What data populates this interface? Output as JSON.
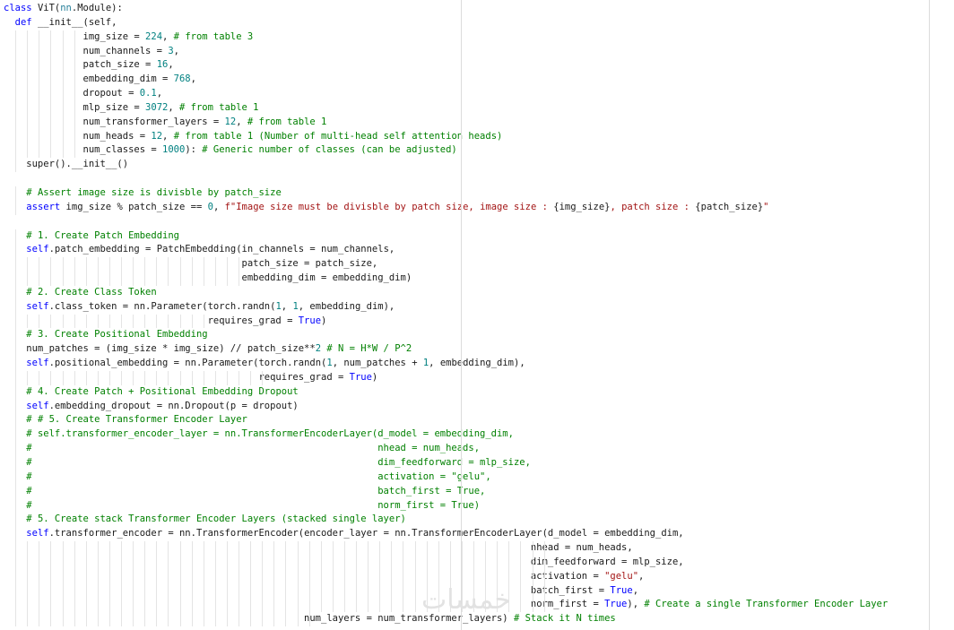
{
  "editor": {
    "lines": [
      [
        {
          "t": "kw",
          "s": "class "
        },
        {
          "t": "plain",
          "s": "ViT("
        },
        {
          "t": "bi",
          "s": "nn"
        },
        {
          "t": "plain",
          "s": ".Module):"
        }
      ],
      [
        {
          "t": "plain",
          "s": "  "
        },
        {
          "t": "kw",
          "s": "def "
        },
        {
          "t": "plain",
          "s": "__init__(self,"
        }
      ],
      [
        {
          "t": "plain",
          "s": "              img_size = "
        },
        {
          "t": "num",
          "s": "224"
        },
        {
          "t": "plain",
          "s": ", "
        },
        {
          "t": "com",
          "s": "# from table 3"
        }
      ],
      [
        {
          "t": "plain",
          "s": "              num_channels = "
        },
        {
          "t": "num",
          "s": "3"
        },
        {
          "t": "plain",
          "s": ","
        }
      ],
      [
        {
          "t": "plain",
          "s": "              patch_size = "
        },
        {
          "t": "num",
          "s": "16"
        },
        {
          "t": "plain",
          "s": ","
        }
      ],
      [
        {
          "t": "plain",
          "s": "              embedding_dim = "
        },
        {
          "t": "num",
          "s": "768"
        },
        {
          "t": "plain",
          "s": ","
        }
      ],
      [
        {
          "t": "plain",
          "s": "              dropout = "
        },
        {
          "t": "num",
          "s": "0.1"
        },
        {
          "t": "plain",
          "s": ","
        }
      ],
      [
        {
          "t": "plain",
          "s": "              mlp_size = "
        },
        {
          "t": "num",
          "s": "3072"
        },
        {
          "t": "plain",
          "s": ", "
        },
        {
          "t": "com",
          "s": "# from table 1"
        }
      ],
      [
        {
          "t": "plain",
          "s": "              num_transformer_layers = "
        },
        {
          "t": "num",
          "s": "12"
        },
        {
          "t": "plain",
          "s": ", "
        },
        {
          "t": "com",
          "s": "# from table 1"
        }
      ],
      [
        {
          "t": "plain",
          "s": "              num_heads = "
        },
        {
          "t": "num",
          "s": "12"
        },
        {
          "t": "plain",
          "s": ", "
        },
        {
          "t": "com",
          "s": "# from table 1 (Number of multi-head self attention heads)"
        }
      ],
      [
        {
          "t": "plain",
          "s": "              num_classes = "
        },
        {
          "t": "num",
          "s": "1000"
        },
        {
          "t": "plain",
          "s": "): "
        },
        {
          "t": "com",
          "s": "# Generic number of classes (can be adjusted)"
        }
      ],
      [
        {
          "t": "plain",
          "s": "    super().__init__()"
        }
      ],
      [
        {
          "t": "plain",
          "s": ""
        }
      ],
      [
        {
          "t": "plain",
          "s": "    "
        },
        {
          "t": "com",
          "s": "# Assert image size is divisble by patch_size"
        }
      ],
      [
        {
          "t": "plain",
          "s": "    "
        },
        {
          "t": "kw",
          "s": "assert"
        },
        {
          "t": "plain",
          "s": " img_size % patch_size == "
        },
        {
          "t": "num",
          "s": "0"
        },
        {
          "t": "plain",
          "s": ", "
        },
        {
          "t": "str",
          "s": "f\"Image size must be divisble by patch size, image size : "
        },
        {
          "t": "plain",
          "s": "{img_size}"
        },
        {
          "t": "str",
          "s": ", patch size : "
        },
        {
          "t": "plain",
          "s": "{patch_size}"
        },
        {
          "t": "str",
          "s": "\""
        }
      ],
      [
        {
          "t": "plain",
          "s": ""
        }
      ],
      [
        {
          "t": "plain",
          "s": "    "
        },
        {
          "t": "com",
          "s": "# 1. Create Patch Embedding"
        }
      ],
      [
        {
          "t": "plain",
          "s": "    "
        },
        {
          "t": "self",
          "s": "self"
        },
        {
          "t": "plain",
          "s": ".patch_embedding = PatchEmbedding(in_channels = num_channels,"
        }
      ],
      [
        {
          "t": "plain",
          "s": "                                          patch_size = patch_size,"
        }
      ],
      [
        {
          "t": "plain",
          "s": "                                          embedding_dim = embedding_dim)"
        }
      ],
      [
        {
          "t": "plain",
          "s": "    "
        },
        {
          "t": "com",
          "s": "# 2. Create Class Token"
        }
      ],
      [
        {
          "t": "plain",
          "s": "    "
        },
        {
          "t": "self",
          "s": "self"
        },
        {
          "t": "plain",
          "s": ".class_token = nn.Parameter(torch.randn("
        },
        {
          "t": "num",
          "s": "1"
        },
        {
          "t": "plain",
          "s": ", "
        },
        {
          "t": "num",
          "s": "1"
        },
        {
          "t": "plain",
          "s": ", embedding_dim),"
        }
      ],
      [
        {
          "t": "plain",
          "s": "                                    requires_grad = "
        },
        {
          "t": "kw",
          "s": "True"
        },
        {
          "t": "plain",
          "s": ")"
        }
      ],
      [
        {
          "t": "plain",
          "s": "    "
        },
        {
          "t": "com",
          "s": "# 3. Create Positional Embedding"
        }
      ],
      [
        {
          "t": "plain",
          "s": "    num_patches = (img_size * img_size) // patch_size**"
        },
        {
          "t": "num",
          "s": "2"
        },
        {
          "t": "plain",
          "s": " "
        },
        {
          "t": "com",
          "s": "# N = H*W / P^2"
        }
      ],
      [
        {
          "t": "plain",
          "s": "    "
        },
        {
          "t": "self",
          "s": "self"
        },
        {
          "t": "plain",
          "s": ".positional_embedding = nn.Parameter(torch.randn("
        },
        {
          "t": "num",
          "s": "1"
        },
        {
          "t": "plain",
          "s": ", num_patches + "
        },
        {
          "t": "num",
          "s": "1"
        },
        {
          "t": "plain",
          "s": ", embedding_dim),"
        }
      ],
      [
        {
          "t": "plain",
          "s": "                                             requires_grad = "
        },
        {
          "t": "kw",
          "s": "True"
        },
        {
          "t": "plain",
          "s": ")"
        }
      ],
      [
        {
          "t": "plain",
          "s": "    "
        },
        {
          "t": "com",
          "s": "# 4. Create Patch + Positional Embedding Dropout"
        }
      ],
      [
        {
          "t": "plain",
          "s": "    "
        },
        {
          "t": "self",
          "s": "self"
        },
        {
          "t": "plain",
          "s": ".embedding_dropout = nn.Dropout(p = dropout)"
        }
      ],
      [
        {
          "t": "plain",
          "s": "    "
        },
        {
          "t": "com",
          "s": "# # 5. Create Transformer Encoder Layer"
        }
      ],
      [
        {
          "t": "plain",
          "s": "    "
        },
        {
          "t": "com",
          "s": "# self.transformer_encoder_layer = nn.TransformerEncoderLayer(d_model = embedding_dim,"
        }
      ],
      [
        {
          "t": "plain",
          "s": "    "
        },
        {
          "t": "com",
          "s": "#                                                             nhead = num_heads,"
        }
      ],
      [
        {
          "t": "plain",
          "s": "    "
        },
        {
          "t": "com",
          "s": "#                                                             dim_feedforward = mlp_size,"
        }
      ],
      [
        {
          "t": "plain",
          "s": "    "
        },
        {
          "t": "com",
          "s": "#                                                             activation = \"gelu\","
        }
      ],
      [
        {
          "t": "plain",
          "s": "    "
        },
        {
          "t": "com",
          "s": "#                                                             batch_first = True,"
        }
      ],
      [
        {
          "t": "plain",
          "s": "    "
        },
        {
          "t": "com",
          "s": "#                                                             norm_first = True)"
        }
      ],
      [
        {
          "t": "plain",
          "s": "    "
        },
        {
          "t": "com",
          "s": "# 5. Create stack Transformer Encoder Layers (stacked single layer)"
        }
      ],
      [
        {
          "t": "plain",
          "s": "    "
        },
        {
          "t": "self",
          "s": "self"
        },
        {
          "t": "plain",
          "s": ".transformer_encoder = nn.TransformerEncoder(encoder_layer = nn.TransformerEncoderLayer(d_model = embedding_dim,"
        }
      ],
      [
        {
          "t": "plain",
          "s": "                                                                                             nhead = num_heads,"
        }
      ],
      [
        {
          "t": "plain",
          "s": "                                                                                             dim_feedforward = mlp_size,"
        }
      ],
      [
        {
          "t": "plain",
          "s": "                                                                                             activation = "
        },
        {
          "t": "str",
          "s": "\"gelu\""
        },
        {
          "t": "plain",
          "s": ","
        }
      ],
      [
        {
          "t": "plain",
          "s": "                                                                                             batch_first = "
        },
        {
          "t": "kw",
          "s": "True"
        },
        {
          "t": "plain",
          "s": ","
        }
      ],
      [
        {
          "t": "plain",
          "s": "                                                                                             norm_first = "
        },
        {
          "t": "kw",
          "s": "True"
        },
        {
          "t": "plain",
          "s": "), "
        },
        {
          "t": "com",
          "s": "# Create a single Transformer Encoder Layer"
        }
      ],
      [
        {
          "t": "plain",
          "s": "                                                     num_layers = num_transformer_layers) "
        },
        {
          "t": "com",
          "s": "# Stack it N times"
        }
      ]
    ]
  },
  "watermark": "خمسات"
}
